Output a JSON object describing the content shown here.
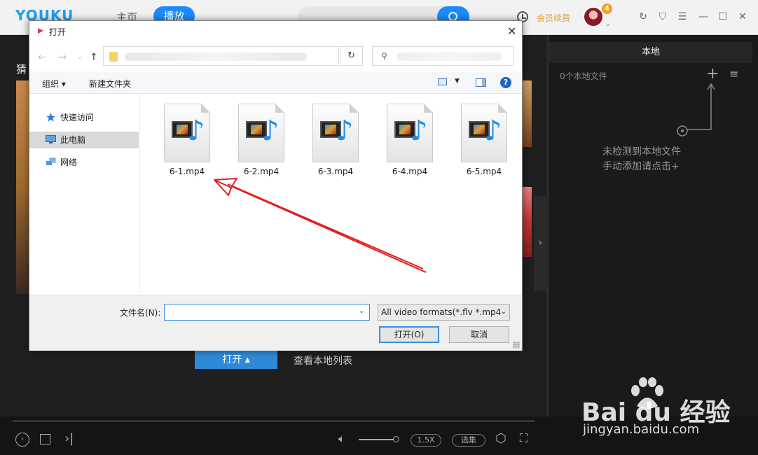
{
  "app": {
    "logo": "YOUKU",
    "nav_home": "主页",
    "nav_play": "播放",
    "vip_renew": "会员续费",
    "badge_count": "4",
    "guess_label": "猜",
    "open_button": "打开",
    "view_local_list": "查看本地列表",
    "speed": "1.5X",
    "episodes": "选集"
  },
  "right_panel": {
    "tab": "本地",
    "file_count": "0个本地文件",
    "empty_line1": "未检测到本地文件",
    "empty_line2": "手动添加请点击+"
  },
  "dialog": {
    "title": "打开",
    "toolbar": {
      "organize": "组织",
      "new_folder": "新建文件夹"
    },
    "nav": [
      {
        "label": "快速访问",
        "icon": "star-icon"
      },
      {
        "label": "此电脑",
        "icon": "computer-icon"
      },
      {
        "label": "网络",
        "icon": "network-icon"
      }
    ],
    "files": [
      "6-1.mp4",
      "6-2.mp4",
      "6-3.mp4",
      "6-4.mp4",
      "6-5.mp4"
    ],
    "filename_label": "文件名(N):",
    "filename_value": "",
    "file_type": "All video formats(*.flv *.mp4",
    "open_button": "打开(O)",
    "cancel_button": "取消"
  },
  "watermark": {
    "brand": "Bai du 经验",
    "url": "jingyan.baidu.com"
  },
  "colors": {
    "accent": "#1a8cff",
    "arrow": "#e02020"
  }
}
